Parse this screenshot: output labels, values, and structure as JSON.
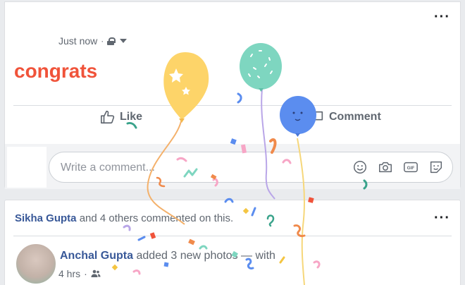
{
  "post": {
    "timestamp": "Just now",
    "text": "congrats",
    "like_label": "Like",
    "comment_label": "Comment",
    "comment_placeholder": "Write a comment..."
  },
  "activity": {
    "name": "Sikha Gupta",
    "rest": " and 4 others commented on this."
  },
  "story": {
    "name": "Anchal Gupta",
    "text": " added 3 new photos — with",
    "time": "4 hrs"
  },
  "colors": {
    "post_text": "#f0533a",
    "link": "#385898",
    "balloon_yellow": "#fdd469",
    "balloon_teal": "#7ed6c0",
    "balloon_blue": "#5b8def"
  },
  "icons": [
    "more-icon",
    "lock-icon",
    "audience-caret-icon",
    "like-icon",
    "comment-icon",
    "emoji-icon",
    "camera-icon",
    "gif-icon",
    "sticker-icon",
    "friends-icon"
  ]
}
